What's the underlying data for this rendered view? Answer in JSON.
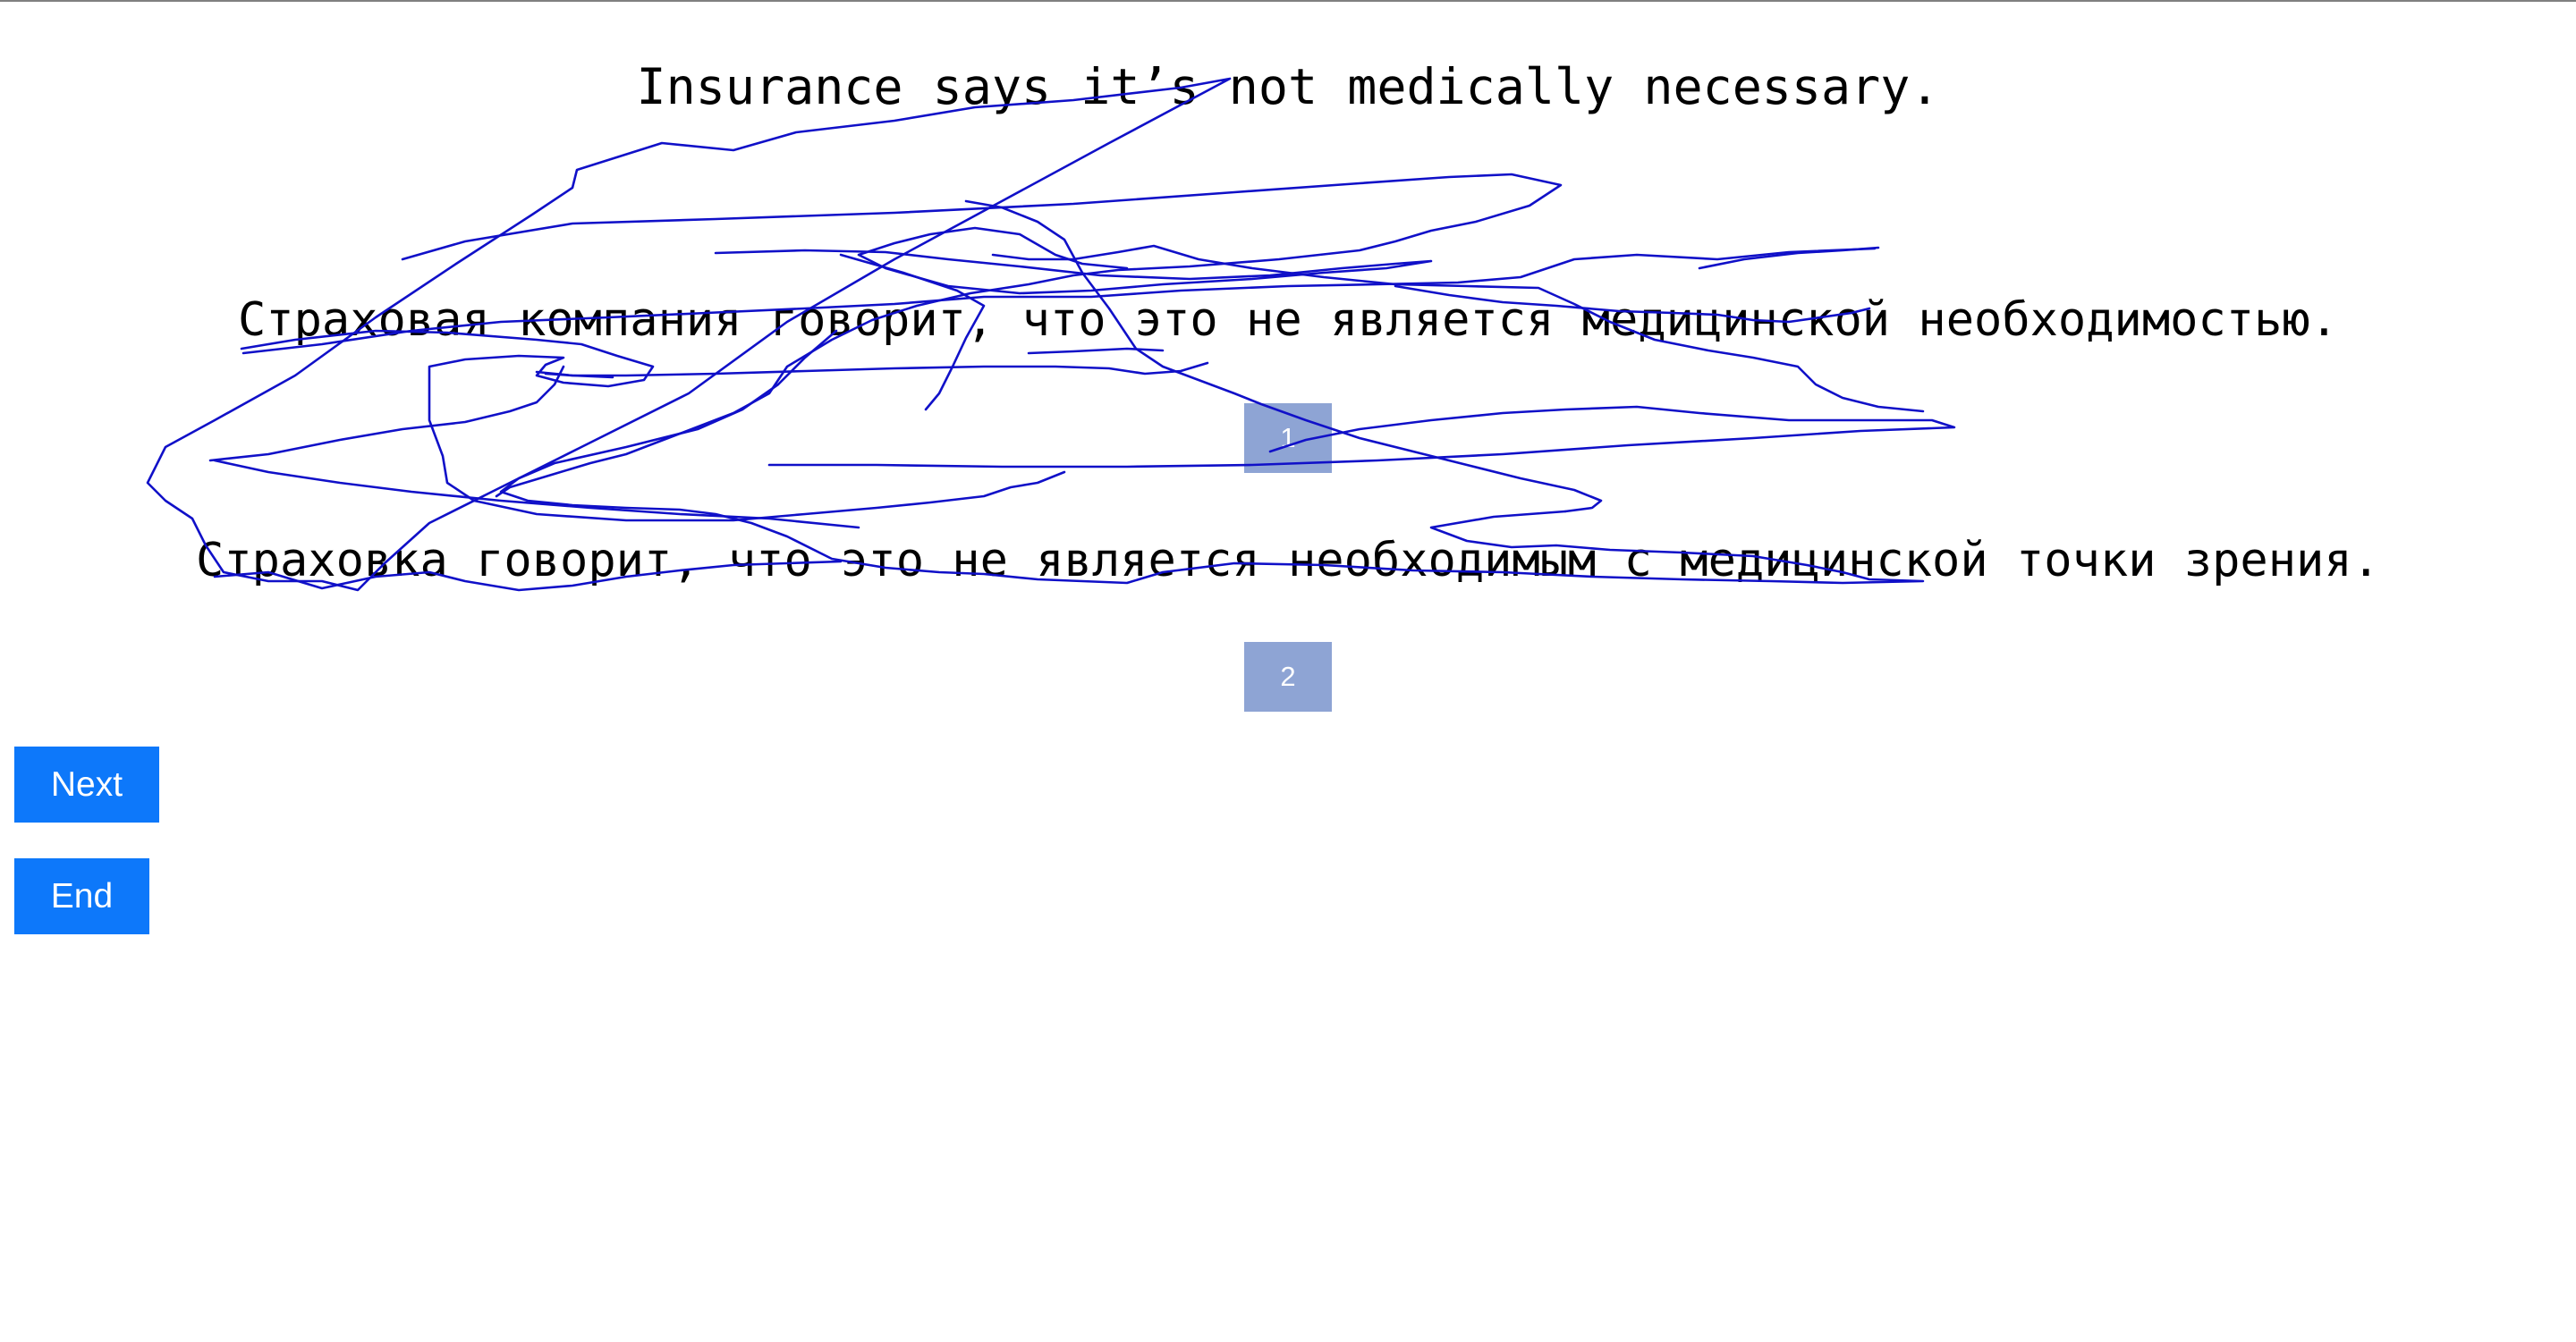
{
  "source_sentence": "Insurance says it’s not medically necessary.",
  "translations": [
    {
      "text": "Страховая компания говорит, что это не является медицинской необходимостью.",
      "choice_label": "1"
    },
    {
      "text": "Страховка говорит, что это не является необходимым с медицинской точки зрения.",
      "choice_label": "2"
    }
  ],
  "buttons": {
    "next_label": "Next",
    "end_label": "End"
  },
  "colors": {
    "choice_box": "#8ea4d4",
    "button": "#0d78fa",
    "scribble_ink": "#1010c8"
  }
}
